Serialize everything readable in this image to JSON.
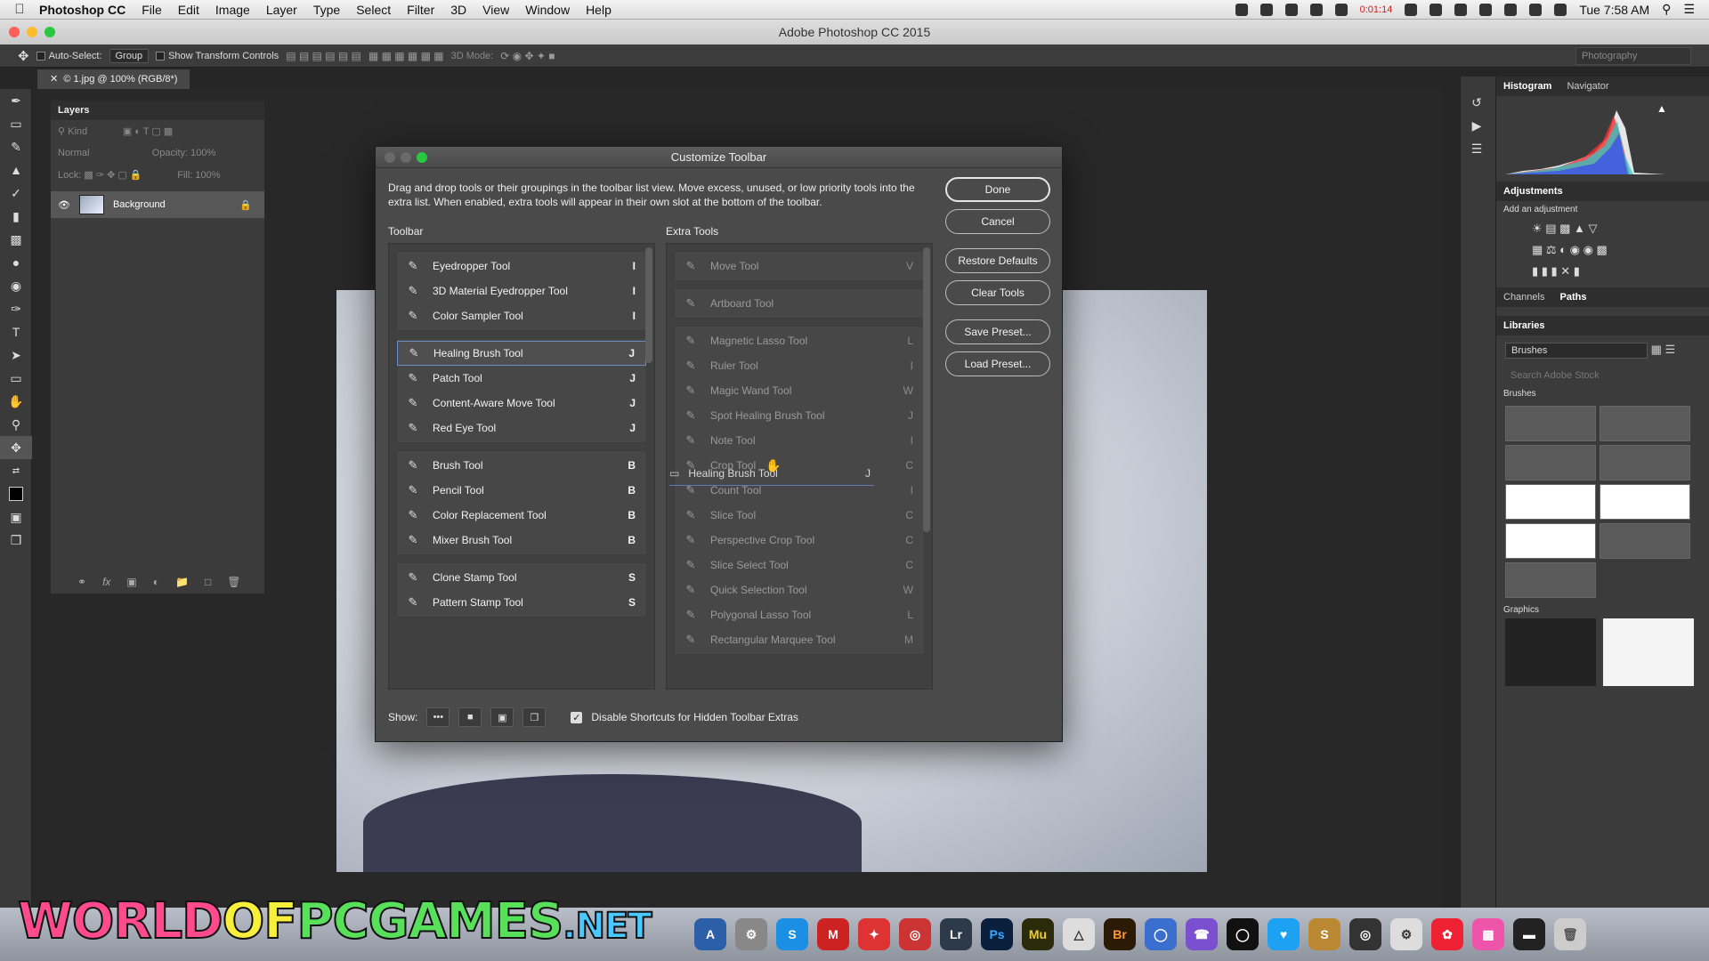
{
  "menubar": {
    "app_name": "Photoshop CC",
    "items": [
      "File",
      "Edit",
      "Image",
      "Layer",
      "Type",
      "Select",
      "Filter",
      "3D",
      "View",
      "Window",
      "Help"
    ],
    "record_time": "0:01:14",
    "clock": "Tue 7:58 AM"
  },
  "window": {
    "title": "Adobe Photoshop CC 2015"
  },
  "options_bar": {
    "auto_select_label": "Auto-Select:",
    "auto_select_value": "Group",
    "transform_label": "Show Transform Controls",
    "mode_3d_label": "3D Mode:",
    "workspace": "Photography"
  },
  "document": {
    "tab": "1.jpg @ 100% (RGB/8*)"
  },
  "layers": {
    "title": "Layers",
    "kind": "Kind",
    "blend_mode": "Normal",
    "opacity_label": "Opacity:",
    "opacity_value": "100%",
    "lock_label": "Lock:",
    "fill_label": "Fill:",
    "fill_value": "100%",
    "layer_name": "Background"
  },
  "right_panels": {
    "tab_histogram": "Histogram",
    "tab_navigator": "Navigator",
    "adjustments_title": "Adjustments",
    "adjustments_sub": "Add an adjustment",
    "tab_channels": "Channels",
    "tab_paths": "Paths",
    "libraries_title": "Libraries",
    "library_select": "Brushes",
    "search_placeholder": "Search Adobe Stock",
    "brushes_label": "Brushes",
    "graphics_label": "Graphics"
  },
  "dialog": {
    "title": "Customize Toolbar",
    "description": "Drag and drop tools or their groupings in the toolbar list view. Move excess, unused, or low priority tools into the extra list. When enabled, extra tools will appear in their own slot at the bottom of the toolbar.",
    "toolbar_header": "Toolbar",
    "extra_header": "Extra Tools",
    "toolbar_groups": [
      [
        {
          "name": "Eyedropper Tool",
          "key": "I",
          "icon": "eyedropper-icon"
        },
        {
          "name": "3D Material Eyedropper Tool",
          "key": "I",
          "icon": "material-eyedropper-icon"
        },
        {
          "name": "Color Sampler Tool",
          "key": "I",
          "icon": "color-sampler-icon"
        }
      ],
      [
        {
          "name": "Healing Brush Tool",
          "key": "J",
          "icon": "healing-brush-icon"
        },
        {
          "name": "Patch Tool",
          "key": "J",
          "icon": "patch-icon"
        },
        {
          "name": "Content-Aware Move Tool",
          "key": "J",
          "icon": "content-aware-move-icon"
        },
        {
          "name": "Red Eye Tool",
          "key": "J",
          "icon": "red-eye-icon"
        }
      ],
      [
        {
          "name": "Brush Tool",
          "key": "B",
          "icon": "brush-icon"
        },
        {
          "name": "Pencil Tool",
          "key": "B",
          "icon": "pencil-icon"
        },
        {
          "name": "Color Replacement Tool",
          "key": "B",
          "icon": "color-replacement-icon"
        },
        {
          "name": "Mixer Brush Tool",
          "key": "B",
          "icon": "mixer-brush-icon"
        }
      ],
      [
        {
          "name": "Clone Stamp Tool",
          "key": "S",
          "icon": "clone-stamp-icon"
        },
        {
          "name": "Pattern Stamp Tool",
          "key": "S",
          "icon": "pattern-stamp-icon"
        }
      ]
    ],
    "extra_groups": [
      [
        {
          "name": "Move Tool",
          "key": "V",
          "icon": "move-icon"
        }
      ],
      [
        {
          "name": "Artboard Tool",
          "key": "",
          "icon": "artboard-icon"
        }
      ],
      [
        {
          "name": "Magnetic Lasso Tool",
          "key": "L",
          "icon": "magnetic-lasso-icon"
        },
        {
          "name": "Ruler Tool",
          "key": "I",
          "icon": "ruler-icon"
        },
        {
          "name": "Magic Wand Tool",
          "key": "W",
          "icon": "magic-wand-icon"
        },
        {
          "name": "Spot Healing Brush Tool",
          "key": "J",
          "icon": "spot-healing-icon"
        },
        {
          "name": "Note Tool",
          "key": "I",
          "icon": "note-icon"
        },
        {
          "name": "Crop Tool",
          "key": "C",
          "icon": "crop-icon"
        },
        {
          "name": "Count Tool",
          "key": "I",
          "icon": "count-icon"
        },
        {
          "name": "Slice Tool",
          "key": "C",
          "icon": "slice-icon"
        },
        {
          "name": "Perspective Crop Tool",
          "key": "C",
          "icon": "perspective-crop-icon"
        },
        {
          "name": "Slice Select Tool",
          "key": "C",
          "icon": "slice-select-icon"
        },
        {
          "name": "Quick Selection Tool",
          "key": "W",
          "icon": "quick-selection-icon"
        },
        {
          "name": "Polygonal Lasso Tool",
          "key": "L",
          "icon": "polygonal-lasso-icon"
        },
        {
          "name": "Rectangular Marquee Tool",
          "key": "M",
          "icon": "rect-marquee-icon"
        }
      ]
    ],
    "drag_ghost": {
      "name": "Healing Brush Tool",
      "key": "J"
    },
    "buttons": {
      "done": "Done",
      "cancel": "Cancel",
      "restore": "Restore Defaults",
      "clear": "Clear Tools",
      "save": "Save Preset...",
      "load": "Load Preset..."
    },
    "show_label": "Show:",
    "disable_shortcuts_label": "Disable Shortcuts for Hidden Toolbar Extras",
    "disable_shortcuts_checked": true
  },
  "dock": {
    "apps": [
      "Lr",
      "Ps",
      "Mu",
      "Br"
    ]
  },
  "watermark": {
    "part1": "WORLD",
    "part2": "OF",
    "part3": "PCGAMES",
    "part4": ".NET"
  }
}
